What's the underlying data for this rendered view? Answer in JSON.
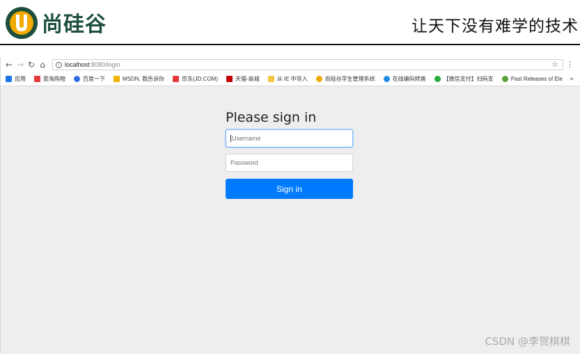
{
  "slide": {
    "logo_text": "尚硅谷",
    "slogan": "让天下没有难学的技术"
  },
  "browser": {
    "address": {
      "host": "localhost",
      "path": ":8080/login"
    },
    "bookmarks": [
      {
        "label": "应用",
        "icon": "apps-grid-icon",
        "color": "#1a73e8"
      },
      {
        "label": "爱淘购物",
        "icon": "taobao-icon",
        "color": "#e4393c"
      },
      {
        "label": "百度一下",
        "icon": "baidu-paw-icon",
        "color": "#2f6ee0"
      },
      {
        "label": "MSDN, 我告诉你",
        "icon": "msdn-icon",
        "color": "#f0b400"
      },
      {
        "label": "京东(JD.COM)",
        "icon": "jd-icon",
        "color": "#e4393c"
      },
      {
        "label": "天猫-商城",
        "icon": "tmall-icon",
        "color": "#c40000"
      },
      {
        "label": "从 IE 中导入",
        "icon": "folder-icon",
        "color": "#f5c542"
      },
      {
        "label": "尚硅谷学生管理系统",
        "icon": "atguigu-icon",
        "color": "#f0a800"
      },
      {
        "label": "在线编码转换",
        "icon": "convert-icon",
        "color": "#1e88e5"
      },
      {
        "label": "【微信支付】扫码支",
        "icon": "wechat-pay-icon",
        "color": "#22ac38"
      },
      {
        "label": "Past Releases of Ele",
        "icon": "electron-icon",
        "color": "#5aa13c"
      }
    ]
  },
  "login": {
    "heading": "Please sign in",
    "username_placeholder": "Username",
    "password_placeholder": "Password",
    "submit_label": "Sign in"
  },
  "watermark": "CSDN @李贺棋棋"
}
